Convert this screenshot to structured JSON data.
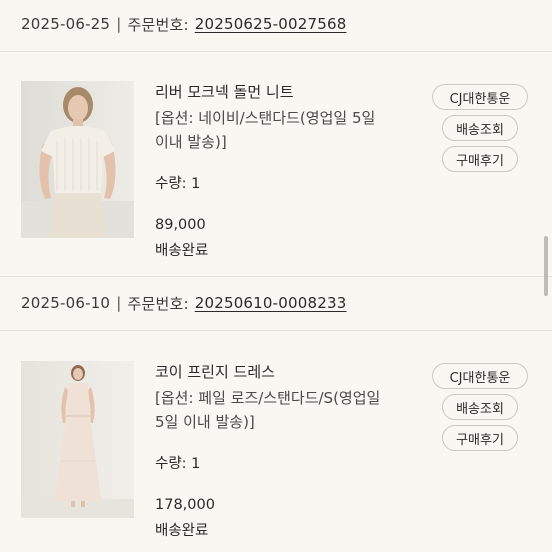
{
  "orders": [
    {
      "date": "2025-06-25",
      "separator": "|",
      "order_label": "주문번호:",
      "order_number": "20250625-0027568",
      "product": {
        "name": "리버 모크넥 돌먼 니트",
        "option_line1": "[옵션: 네이비/스탠다드(영업일 5일",
        "option_line2": "이내 발송)]",
        "quantity": "수량: 1",
        "price": "89,000",
        "status": "배송완료"
      },
      "buttons": {
        "carrier": "CJ대한통운",
        "track": "배송조회",
        "review": "구매후기"
      }
    },
    {
      "date": "2025-06-10",
      "separator": "|",
      "order_label": "주문번호:",
      "order_number": "20250610-0008233",
      "product": {
        "name": "코이 프린지 드레스",
        "option_line1": "[옵션: 페일 로즈/스탠다드/S(영업일",
        "option_line2": "5일 이내 발송)]",
        "quantity": "수량: 1",
        "price": "178,000",
        "status": "배송완료"
      },
      "buttons": {
        "carrier": "CJ대한통운",
        "track": "배송조회",
        "review": "구매후기"
      }
    }
  ],
  "colors": {
    "background": "#f8f7f1",
    "text": "#2b2b2b",
    "button_border": "#c9c9c6",
    "divider": "#e4e2da"
  }
}
